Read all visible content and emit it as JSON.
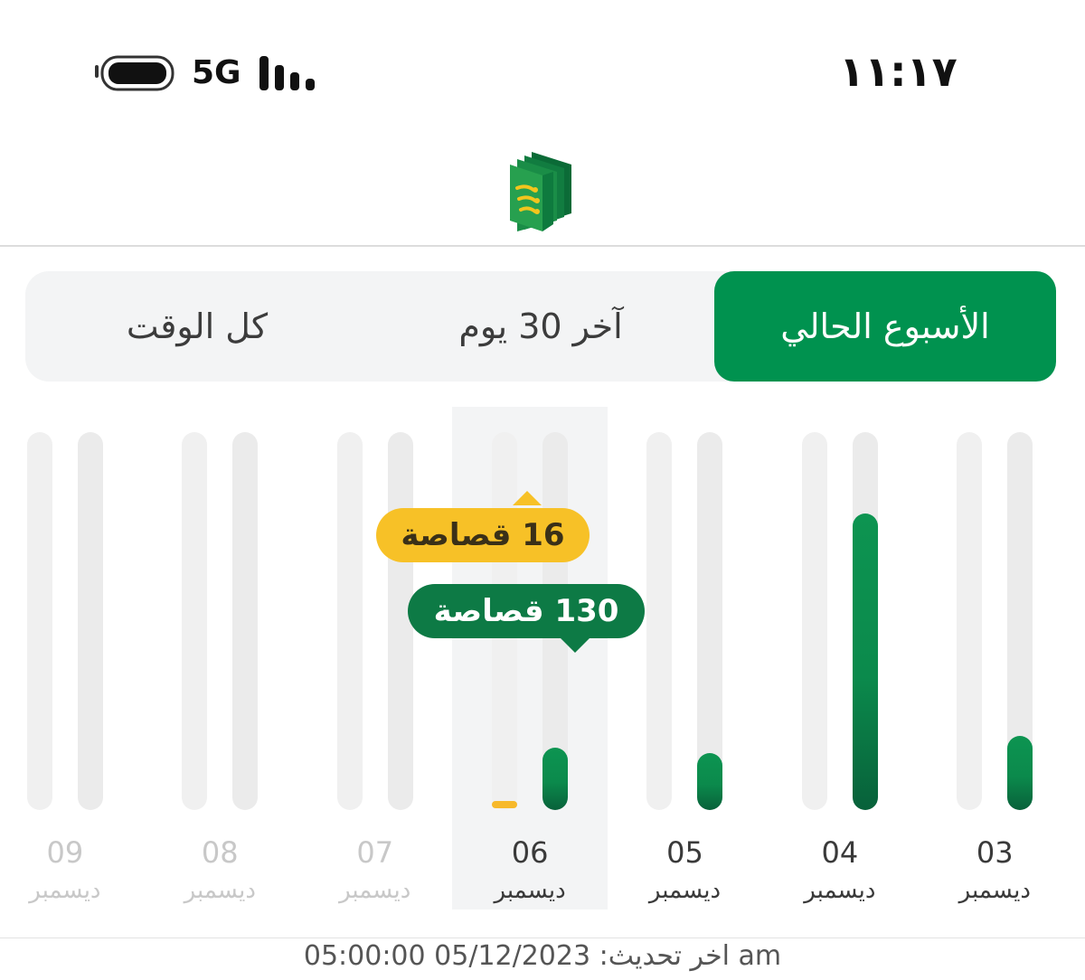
{
  "status_bar": {
    "time": "١١:١٧",
    "network": "5G",
    "icons": [
      "battery-icon",
      "signal-bars-icon"
    ]
  },
  "logo": {
    "icon": "bank-logo-icon",
    "colors": [
      "#0b7a3f",
      "#1f9a4f",
      "#f3c51d"
    ]
  },
  "tabs": [
    {
      "id": "tab-week",
      "label": "الأسبوع الحالي",
      "active": true
    },
    {
      "id": "tab-30",
      "label": "آخر 30 يوم",
      "active": false
    },
    {
      "id": "tab-all",
      "label": "كل الوقت",
      "active": false
    }
  ],
  "accent_color": "#00924f",
  "secondary_color": "#f7c127",
  "chart_data": {
    "type": "bar",
    "categories": [
      "03 ديسمبر",
      "04 ديسمبر",
      "05 ديسمبر",
      "06 ديسمبر",
      "07 ديسمبر",
      "08 ديسمبر",
      "09 ديسمبر"
    ],
    "days": [
      {
        "day": "03",
        "month": "ديسمبر",
        "green": 155,
        "yellow": 0,
        "future": false
      },
      {
        "day": "04",
        "month": "ديسمبر",
        "green": 620,
        "yellow": 0,
        "future": false
      },
      {
        "day": "05",
        "month": "ديسمبر",
        "green": 120,
        "yellow": 0,
        "future": false
      },
      {
        "day": "06",
        "month": "ديسمبر",
        "green": 130,
        "yellow": 16,
        "future": false,
        "selected": true
      },
      {
        "day": "07",
        "month": "ديسمبر",
        "green": 0,
        "yellow": 0,
        "future": true
      },
      {
        "day": "08",
        "month": "ديسمبر",
        "green": 0,
        "yellow": 0,
        "future": true
      },
      {
        "day": "09",
        "month": "ديسمبر",
        "green": 0,
        "yellow": 0,
        "future": true
      }
    ],
    "series_colors": {
      "green": "#0b8a4c",
      "yellow": "#f7b92b"
    },
    "ylim": [
      0,
      790
    ]
  },
  "tooltips": {
    "yellow": "16 قصاصة",
    "green": "130 قصاصة"
  },
  "footer": {
    "last_updated": "اخر تحديث: 05/12/2023 05:00:00 am"
  }
}
